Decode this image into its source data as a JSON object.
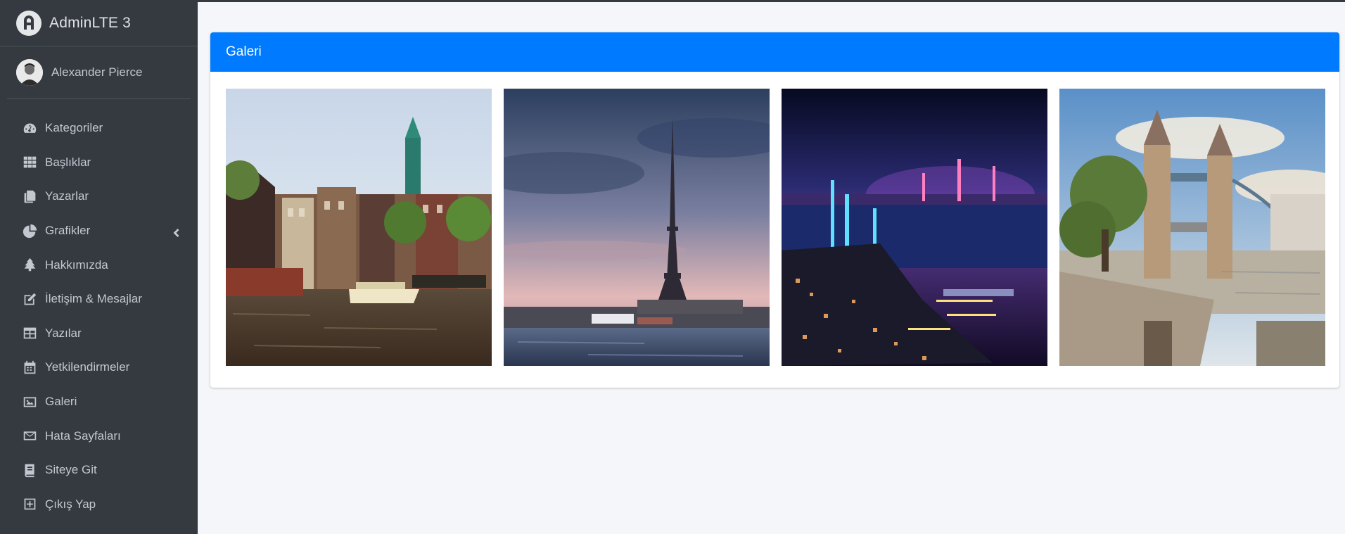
{
  "brand": {
    "name": "AdminLTE 3",
    "logo_icon": "adminlte-logo-icon"
  },
  "user": {
    "name": "Alexander Pierce",
    "avatar_icon": "user-avatar"
  },
  "nav": {
    "items": [
      {
        "label": "Kategoriler",
        "icon": "tachometer-icon"
      },
      {
        "label": "Başlıklar",
        "icon": "grid-icon"
      },
      {
        "label": "Yazarlar",
        "icon": "copy-icon"
      },
      {
        "label": "Grafikler",
        "icon": "pie-chart-icon",
        "expandable": true
      },
      {
        "label": "Hakkımızda",
        "icon": "tree-icon"
      },
      {
        "label": "İletişim & Mesajlar",
        "icon": "edit-icon"
      },
      {
        "label": "Yazılar",
        "icon": "table-icon"
      },
      {
        "label": "Yetkilendirmeler",
        "icon": "calendar-icon"
      },
      {
        "label": "Galeri",
        "icon": "image-icon"
      },
      {
        "label": "Hata Sayfaları",
        "icon": "envelope-icon"
      },
      {
        "label": "Siteye Git",
        "icon": "book-icon"
      },
      {
        "label": "Çıkış Yap",
        "icon": "plus-square-icon"
      }
    ]
  },
  "gallery": {
    "title": "Galeri",
    "photos": [
      {
        "subject": "amsterdam-canal"
      },
      {
        "subject": "eiffel-tower"
      },
      {
        "subject": "night-city-harbor"
      },
      {
        "subject": "tower-bridge"
      }
    ]
  },
  "colors": {
    "sidebar": "#343a40",
    "accent": "#007bff",
    "background": "#f4f6f9"
  }
}
